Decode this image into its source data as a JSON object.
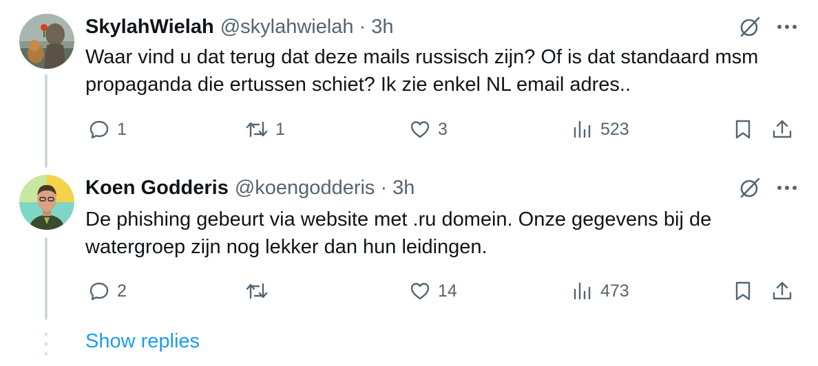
{
  "tweets": [
    {
      "name": "SkylahWielah",
      "handle": "@skylahwielah",
      "separator": "·",
      "time": "3h",
      "text": "Waar vind u dat terug dat deze mails russisch zijn? Of is dat standaard msm propaganda die ertussen schiet? Ik zie enkel NL email adres..",
      "replies": "1",
      "reposts": "1",
      "likes": "3",
      "views": "523"
    },
    {
      "name": "Koen Godderis",
      "handle": "@koengodderis",
      "separator": "·",
      "time": "3h",
      "text": "De phishing gebeurt via website met .ru domein. Onze gegevens bij de watergroep zijn nog lekker dan hun leidingen.",
      "replies": "2",
      "reposts": "",
      "likes": "14",
      "views": "473"
    }
  ],
  "show_replies_label": "Show replies",
  "icons": [
    "grok-icon",
    "more-icon",
    "reply-icon",
    "repost-icon",
    "like-icon",
    "views-icon",
    "bookmark-icon",
    "share-icon"
  ],
  "colors": {
    "text": "#0f1419",
    "secondary": "#536471",
    "link": "#1d9bf0",
    "thread_line": "#cfd9de"
  }
}
